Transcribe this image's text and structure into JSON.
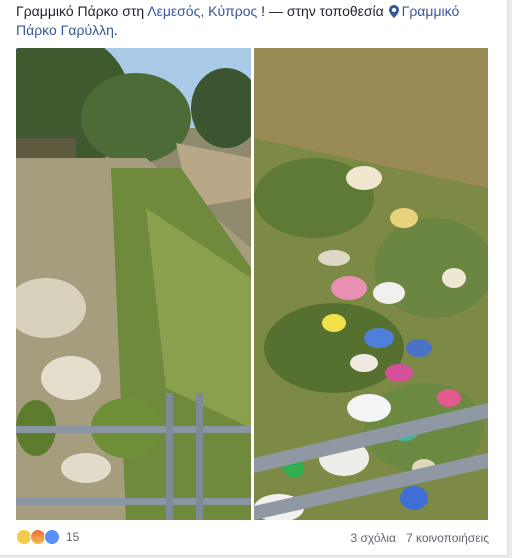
{
  "post": {
    "text_part1": "Γραμμικό Πάρκο στη ",
    "location_link": "Λεμεσός, Κύπρος",
    "text_part2": " ! — στην τοποθεσία ",
    "place_link": "Γραμμικό Πάρκο Γαρύλλη",
    "text_end": "."
  },
  "photos": [
    {
      "name": "Stream bed with litter and railing"
    },
    {
      "name": "Plastic bags and trash on slope"
    }
  ],
  "footer": {
    "reaction_icons": [
      "sad-icon",
      "angry-icon",
      "like-icon"
    ],
    "reaction_count": "15",
    "comments": "3 σχόλια",
    "shares": "7 κοινοποιήσεις"
  },
  "colors": {
    "link": "#365899",
    "text": "#1d2129",
    "meta": "#606770",
    "background": "#e9ebee"
  }
}
